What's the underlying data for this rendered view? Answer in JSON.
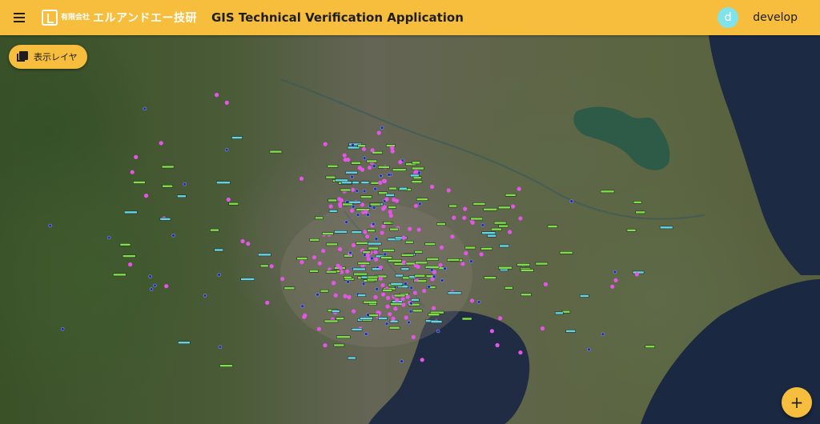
{
  "header": {
    "company_prefix": "有限会社",
    "company_name": "エルアンドエー技研",
    "app_title": "GIS Technical Verification Application",
    "user_initial": "d",
    "username": "develop"
  },
  "map": {
    "layer_button_label": "表示レイヤ",
    "fab_label": "+"
  },
  "colors": {
    "accent": "#f7bd3c",
    "avatar": "#80e3ec",
    "marker_green": "#7fe04a",
    "marker_cyan": "#62d7e6",
    "marker_magenta": "#e455e8",
    "marker_navy": "#2230a8"
  },
  "icons": [
    "menu-icon",
    "company-logo-icon",
    "layers-icon",
    "plus-icon"
  ]
}
